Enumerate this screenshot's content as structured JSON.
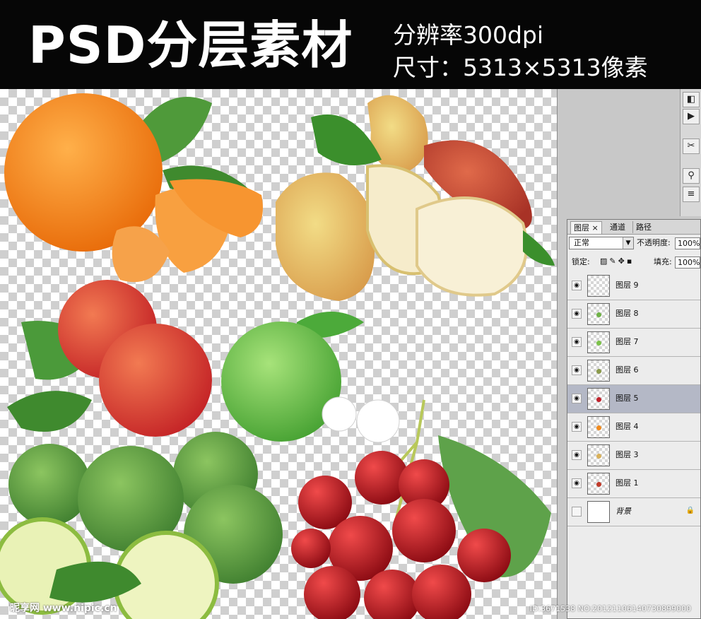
{
  "banner": {
    "title": "PSD分层素材",
    "resolution": "分辨率300dpi",
    "size": "尺寸：5313×5313像素"
  },
  "layers_panel": {
    "tabs": [
      "图层",
      "通道",
      "路径"
    ],
    "tab_close": "×",
    "blend_mode": "正常",
    "opacity_label": "不透明度:",
    "opacity_value": "100%",
    "lock_label": "锁定:",
    "fill_label": "填充:",
    "fill_value": "100%",
    "layers": [
      {
        "name": "图层 9",
        "visible": true,
        "selected": false,
        "dot": ""
      },
      {
        "name": "图层 8",
        "visible": true,
        "selected": false,
        "dot": "#6fb246"
      },
      {
        "name": "图层 7",
        "visible": true,
        "selected": false,
        "dot": "#7cc24a"
      },
      {
        "name": "图层 6",
        "visible": true,
        "selected": false,
        "dot": "#8a9a4a"
      },
      {
        "name": "图层 5",
        "visible": true,
        "selected": true,
        "dot": "#c0202a"
      },
      {
        "name": "图层 4",
        "visible": true,
        "selected": false,
        "dot": "#f08a1e"
      },
      {
        "name": "图层 3",
        "visible": true,
        "selected": false,
        "dot": "#d9b15a"
      },
      {
        "name": "图层 1",
        "visible": true,
        "selected": false,
        "dot": "#c03a2a"
      },
      {
        "name": "背景",
        "visible": false,
        "selected": false,
        "dot": "",
        "locked": true
      }
    ]
  },
  "footer": {
    "watermark": "昵享网 www.nipic.cn",
    "id_text": "ID:3671538 NO:20121106140730899000"
  }
}
